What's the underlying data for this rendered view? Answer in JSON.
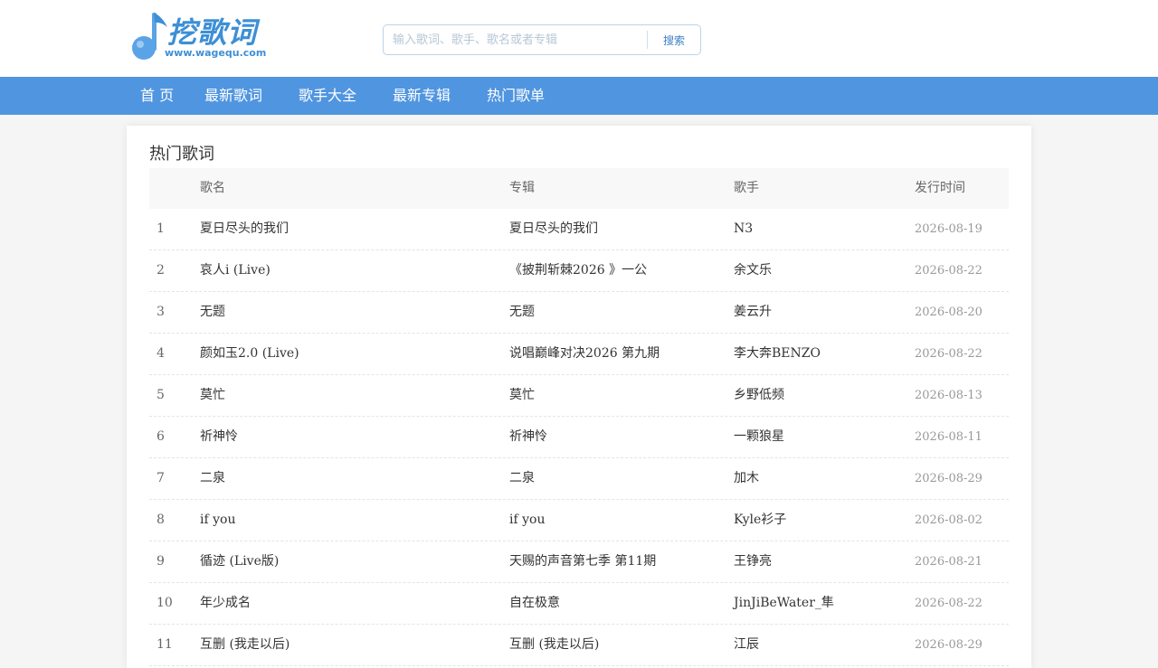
{
  "logo": {
    "text": "挖歌词",
    "url": "www.wagequ.com"
  },
  "search": {
    "placeholder": "输入歌词、歌手、歌名或者专辑",
    "value": "",
    "button_label": "搜索"
  },
  "nav": {
    "items": [
      {
        "label": "首 页"
      },
      {
        "label": "最新歌词"
      },
      {
        "label": "歌手大全"
      },
      {
        "label": "最新专辑"
      },
      {
        "label": "热门歌单"
      }
    ]
  },
  "section": {
    "title": "热门歌词"
  },
  "table": {
    "headers": {
      "num": "",
      "song": "歌名",
      "album": "专辑",
      "artist": "歌手",
      "date": "发行时间"
    },
    "rows": [
      {
        "num": "1",
        "song": "夏日尽头的我们",
        "album": "夏日尽头的我们",
        "artist": "N3",
        "date": "2026-08-19"
      },
      {
        "num": "2",
        "song": "哀人i (Live)",
        "album": "《披荆斩棘2026 》一公",
        "artist": "余文乐",
        "date": "2026-08-22"
      },
      {
        "num": "3",
        "song": "无题",
        "album": "无题",
        "artist": "姜云升",
        "date": "2026-08-20"
      },
      {
        "num": "4",
        "song": "颜如玉2.0 (Live)",
        "album": "说唱巅峰对决2026 第九期",
        "artist": "李大奔BENZO",
        "date": "2026-08-22"
      },
      {
        "num": "5",
        "song": "莫忙",
        "album": "莫忙",
        "artist": "乡野低频",
        "date": "2026-08-13"
      },
      {
        "num": "6",
        "song": "祈神怜",
        "album": "祈神怜",
        "artist": "一颗狼星",
        "date": "2026-08-11"
      },
      {
        "num": "7",
        "song": "二泉",
        "album": "二泉",
        "artist": "加木",
        "date": "2026-08-29"
      },
      {
        "num": "8",
        "song": "if you",
        "album": "if you",
        "artist": "Kyle衫子",
        "date": "2026-08-02"
      },
      {
        "num": "9",
        "song": "循迹 (Live版)",
        "album": "天赐的声音第七季 第11期",
        "artist": "王铮亮",
        "date": "2026-08-21"
      },
      {
        "num": "10",
        "song": "年少成名",
        "album": "自在极意",
        "artist": "JinJiBeWater_隼",
        "date": "2026-08-22"
      },
      {
        "num": "11",
        "song": "互删 (我走以后)",
        "album": "互删 (我走以后)",
        "artist": "江辰",
        "date": "2026-08-29"
      }
    ]
  },
  "colors": {
    "brand": "#3d8fd6",
    "nav_bg": "#5095e0",
    "date_text": "#999999"
  },
  "icons": {
    "logo": "music-note-icon"
  }
}
